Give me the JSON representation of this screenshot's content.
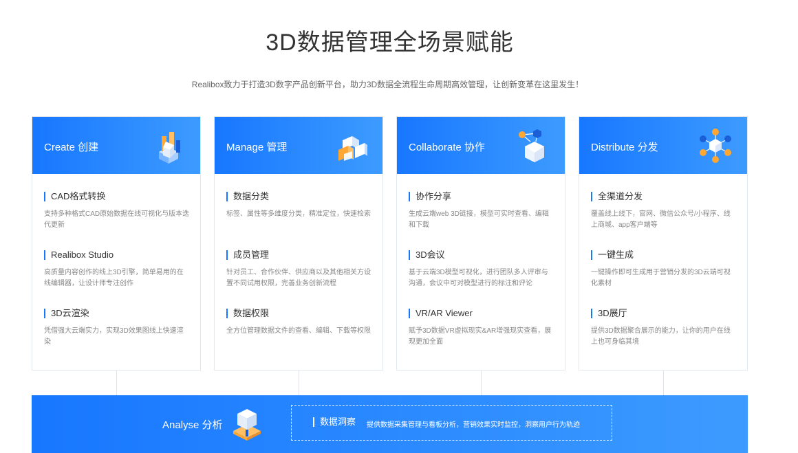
{
  "header": {
    "title": "3D数据管理全场景赋能",
    "subtitle": "Realibox致力于打造3D数字产品创新平台，助力3D数据全流程生命周期高效管理，让创新变革在这里发生！"
  },
  "colors": {
    "accent": "#1777ff",
    "accent_light": "#3d9bff",
    "orange": "#ffa733"
  },
  "cards": [
    {
      "title": "Create 创建",
      "icon": "create-cubes-icon",
      "features": [
        {
          "title": "CAD格式转换",
          "desc": "支持多种格式CAD原始数据在线可视化与版本迭代更新"
        },
        {
          "title": "Realibox Studio",
          "desc": "高质量内容创作的线上3D引擎，简单易用的在线编辑器，让设计师专注创作"
        },
        {
          "title": "3D云渲染",
          "desc": "凭借强大云端实力，实现3D效果图线上快速渲染"
        }
      ]
    },
    {
      "title": "Manage 管理",
      "icon": "manage-blocks-icon",
      "features": [
        {
          "title": "数据分类",
          "desc": "标签、属性等多维度分类，精准定位，快速检索"
        },
        {
          "title": "成员管理",
          "desc": "针对员工、合作伙伴、供应商以及其他相关方设置不同试用权限，完善业务创新流程"
        },
        {
          "title": "数据权限",
          "desc": "全方位管理数据文件的查看、编辑、下载等权限"
        }
      ]
    },
    {
      "title": "Collaborate 协作",
      "icon": "collaborate-network-icon",
      "features": [
        {
          "title": "协作分享",
          "desc": "生成云端web 3D链接，模型可实时查看、编辑和下载"
        },
        {
          "title": "3D会议",
          "desc": "基于云端3D模型可视化，进行团队多人评审与沟通，会议中可对模型进行的标注和评论"
        },
        {
          "title": "VR/AR Viewer",
          "desc": "赋予3D数据VR虚拟现实&AR增强现实查看，展现更加全面"
        }
      ]
    },
    {
      "title": "Distribute 分发",
      "icon": "distribute-hub-icon",
      "features": [
        {
          "title": "全渠道分发",
          "desc": "覆盖线上线下，官网、微信公众号/小程序、线上商城、app客户端等"
        },
        {
          "title": "一键生成",
          "desc": "一键操作即可生成用于营销分发的3D云端可视化素材"
        },
        {
          "title": "3D展厅",
          "desc": "提供3D数据聚合展示的能力，让你的用户在线上也可身临其境"
        }
      ]
    }
  ],
  "analyse": {
    "title": "Analyse 分析",
    "icon": "analyse-box-icon",
    "insight_title": "数据洞察",
    "insight_desc": "提供数据采集管理与看板分析，营销效果实时监控，洞察用户行为轨迹"
  }
}
